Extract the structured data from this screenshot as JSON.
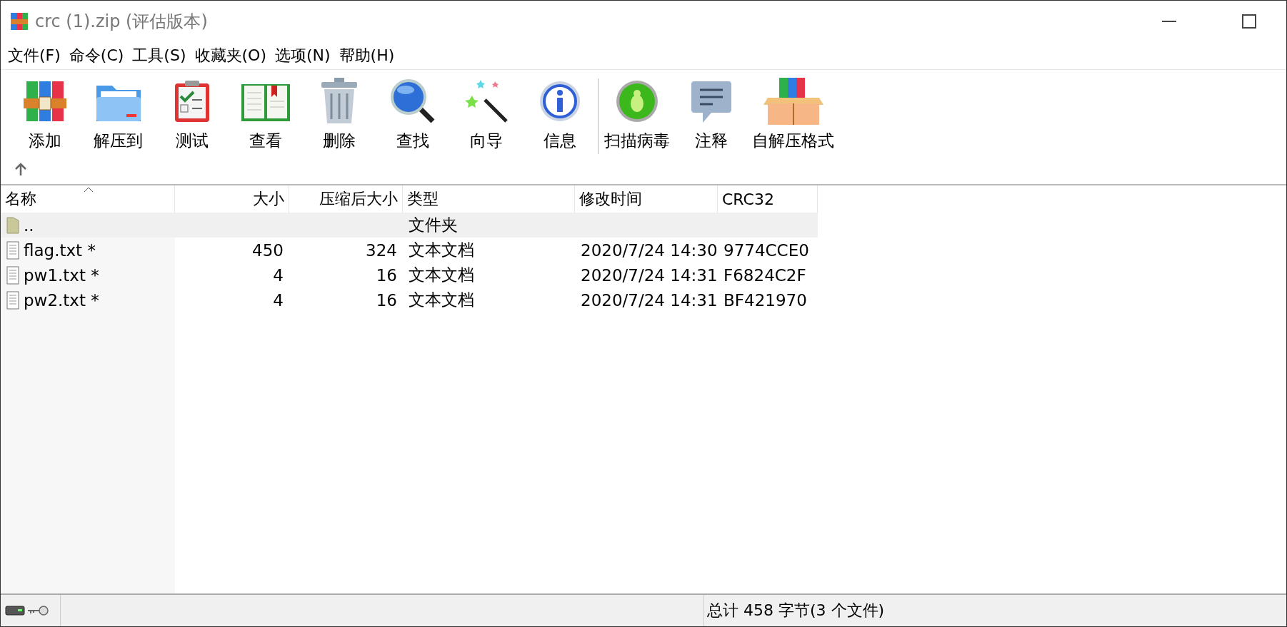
{
  "window": {
    "title": "crc (1).zip (评估版本)"
  },
  "menu": [
    "文件(F)",
    "命令(C)",
    "工具(S)",
    "收藏夹(O)",
    "选项(N)",
    "帮助(H)"
  ],
  "toolbar": {
    "groups": [
      [
        "添加",
        "解压到",
        "测试",
        "查看",
        "删除",
        "查找",
        "向导",
        "信息"
      ],
      [
        "扫描病毒",
        "注释",
        "自解压格式"
      ]
    ]
  },
  "table": {
    "columns": [
      {
        "label": "名称",
        "sorted": true
      },
      {
        "label": "大小",
        "sorted": false
      },
      {
        "label": "压缩后大小",
        "sorted": false
      },
      {
        "label": "类型",
        "sorted": false
      },
      {
        "label": "修改时间",
        "sorted": false
      },
      {
        "label": "CRC32",
        "sorted": false
      }
    ],
    "rows": [
      {
        "kind": "folder",
        "cells": [
          "..",
          "",
          "",
          "文件夹",
          "",
          ""
        ]
      },
      {
        "kind": "file",
        "cells": [
          "flag.txt *",
          "450",
          "324",
          "文本文档",
          "2020/7/24 14:30",
          "9774CCE0"
        ]
      },
      {
        "kind": "file",
        "cells": [
          "pw1.txt *",
          "4",
          "16",
          "文本文档",
          "2020/7/24 14:31",
          "F6824C2F"
        ]
      },
      {
        "kind": "file",
        "cells": [
          "pw2.txt *",
          "4",
          "16",
          "文本文档",
          "2020/7/24 14:31",
          "BF421970"
        ]
      }
    ]
  },
  "status_bar": {
    "summary": "总计 458 字节(3 个文件)"
  }
}
